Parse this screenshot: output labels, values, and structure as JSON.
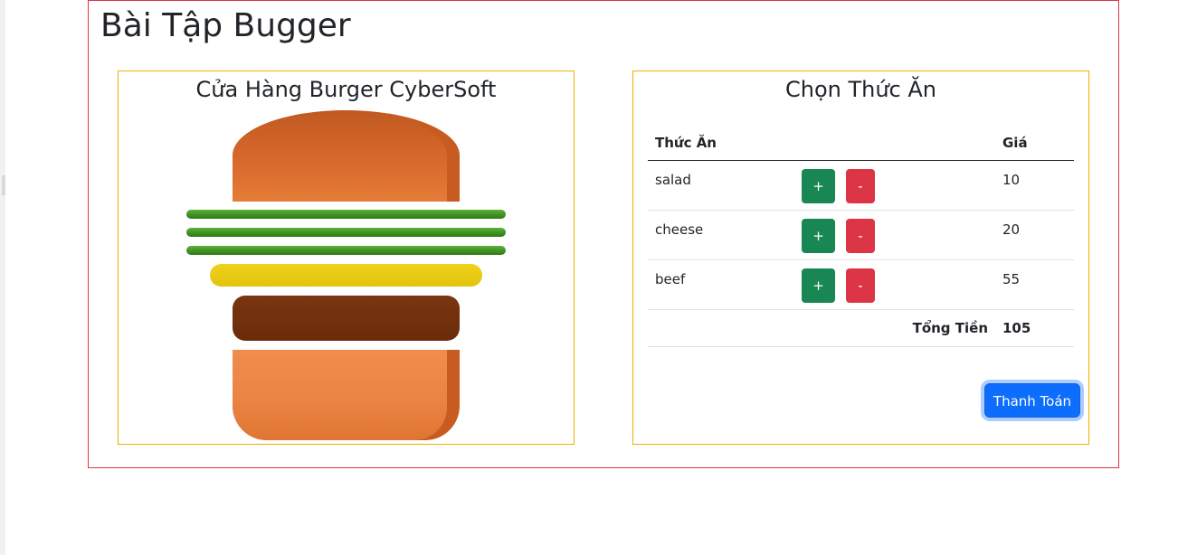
{
  "page": {
    "title": "Bài Tập Bugger"
  },
  "burger_panel": {
    "title": "Cửa Hàng Burger CyberSoft",
    "layers": [
      "bread-top",
      "salad",
      "cheese",
      "beef",
      "bread-bottom"
    ],
    "colors": {
      "bread": "#e57c38",
      "salad": "#3f8f22",
      "cheese": "#e8c912",
      "beef": "#732f0d"
    }
  },
  "menu_panel": {
    "title": "Chọn Thức Ăn",
    "headers": {
      "food": "Thức Ăn",
      "price": "Giá"
    },
    "items": [
      {
        "name": "salad",
        "plus": "+",
        "minus": "-",
        "price": "10"
      },
      {
        "name": "cheese",
        "plus": "+",
        "minus": "-",
        "price": "20"
      },
      {
        "name": "beef",
        "plus": "+",
        "minus": "-",
        "price": "55"
      }
    ],
    "total_label": "Tổng Tiền",
    "total_value": "105",
    "pay_button": "Thanh Toán"
  }
}
